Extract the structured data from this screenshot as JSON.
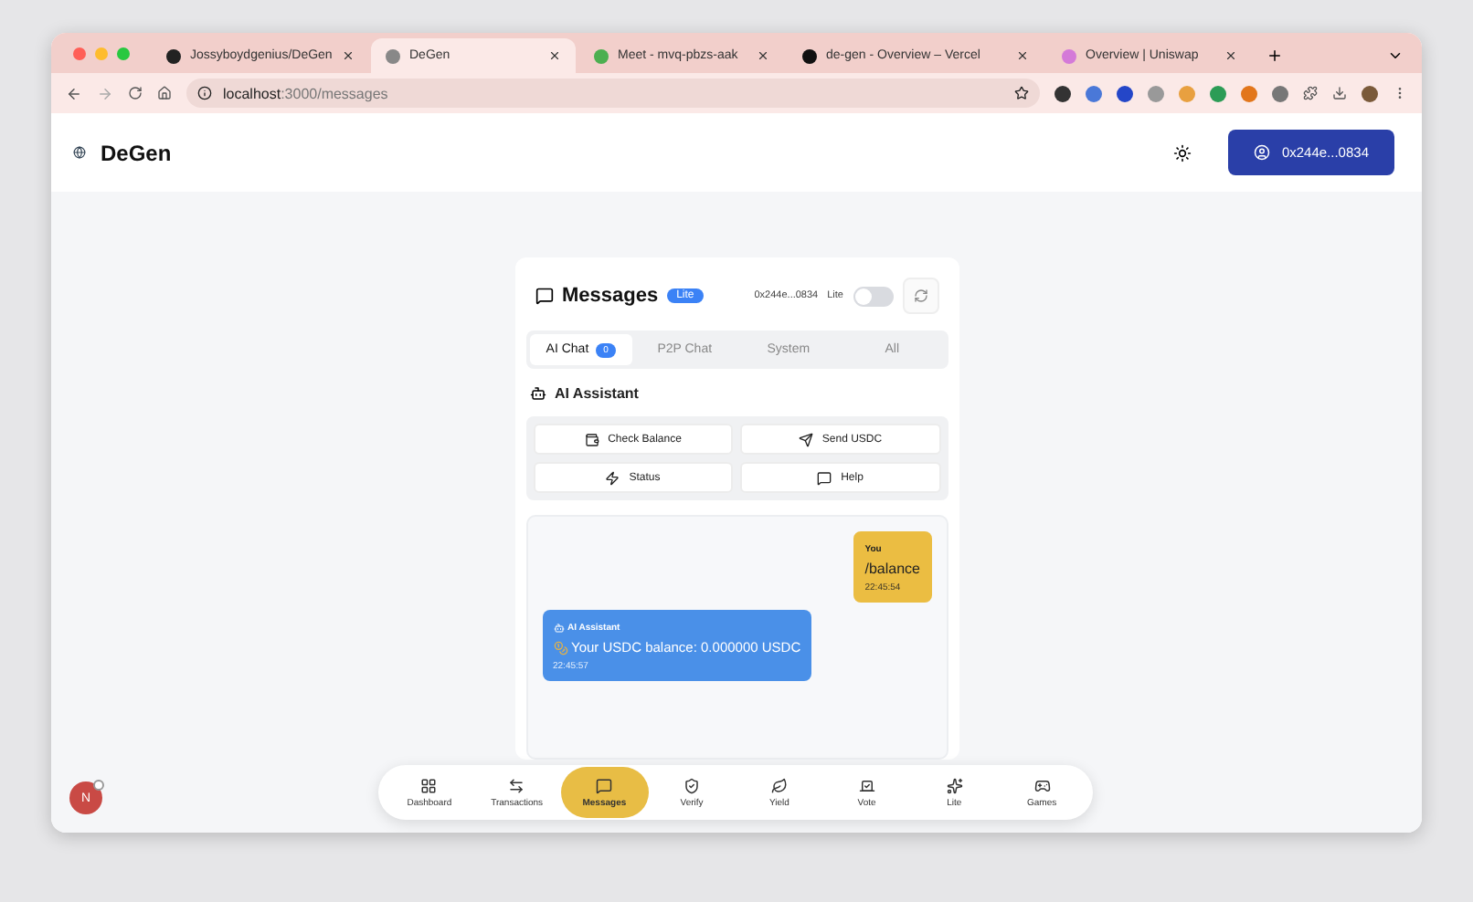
{
  "browser": {
    "tabs": [
      {
        "title": "Jossyboydgenius/DeGen",
        "selected": false
      },
      {
        "title": "DeGen",
        "selected": true
      },
      {
        "title": "Meet - mvq-pbzs-aak",
        "selected": false
      },
      {
        "title": "de-gen - Overview – Vercel",
        "selected": false
      },
      {
        "title": "Overview | Uniswap",
        "selected": false
      }
    ],
    "address": {
      "host": "localhost",
      "path": ":3000/messages"
    }
  },
  "header": {
    "brand": "DeGen",
    "wallet": "0x244e...0834"
  },
  "messages": {
    "title": "Messages",
    "badge": "Lite",
    "address": "0x244e...0834",
    "toggle_label": "Lite",
    "lite_on": false,
    "tabs": [
      {
        "label": "AI Chat",
        "count": "0",
        "selected": true
      },
      {
        "label": "P2P Chat",
        "selected": false
      },
      {
        "label": "System",
        "selected": false
      },
      {
        "label": "All",
        "selected": false
      }
    ],
    "section": "AI Assistant",
    "actions": [
      "Check Balance",
      "Send USDC",
      "Status",
      "Help"
    ],
    "chat": [
      {
        "kind": "user",
        "sender": "You",
        "text": "/balance",
        "time": "22:45:54"
      },
      {
        "kind": "assistant",
        "sender": "AI Assistant",
        "text": "Your USDC balance: 0.000000 USDC",
        "time": "22:45:57"
      }
    ]
  },
  "nav": [
    {
      "label": "Dashboard",
      "selected": false
    },
    {
      "label": "Transactions",
      "selected": false
    },
    {
      "label": "Messages",
      "selected": true
    },
    {
      "label": "Verify",
      "selected": false
    },
    {
      "label": "Yield",
      "selected": false
    },
    {
      "label": "Vote",
      "selected": false
    },
    {
      "label": "Lite",
      "selected": false
    },
    {
      "label": "Games",
      "selected": false
    }
  ],
  "avatar": {
    "initial": "N"
  }
}
